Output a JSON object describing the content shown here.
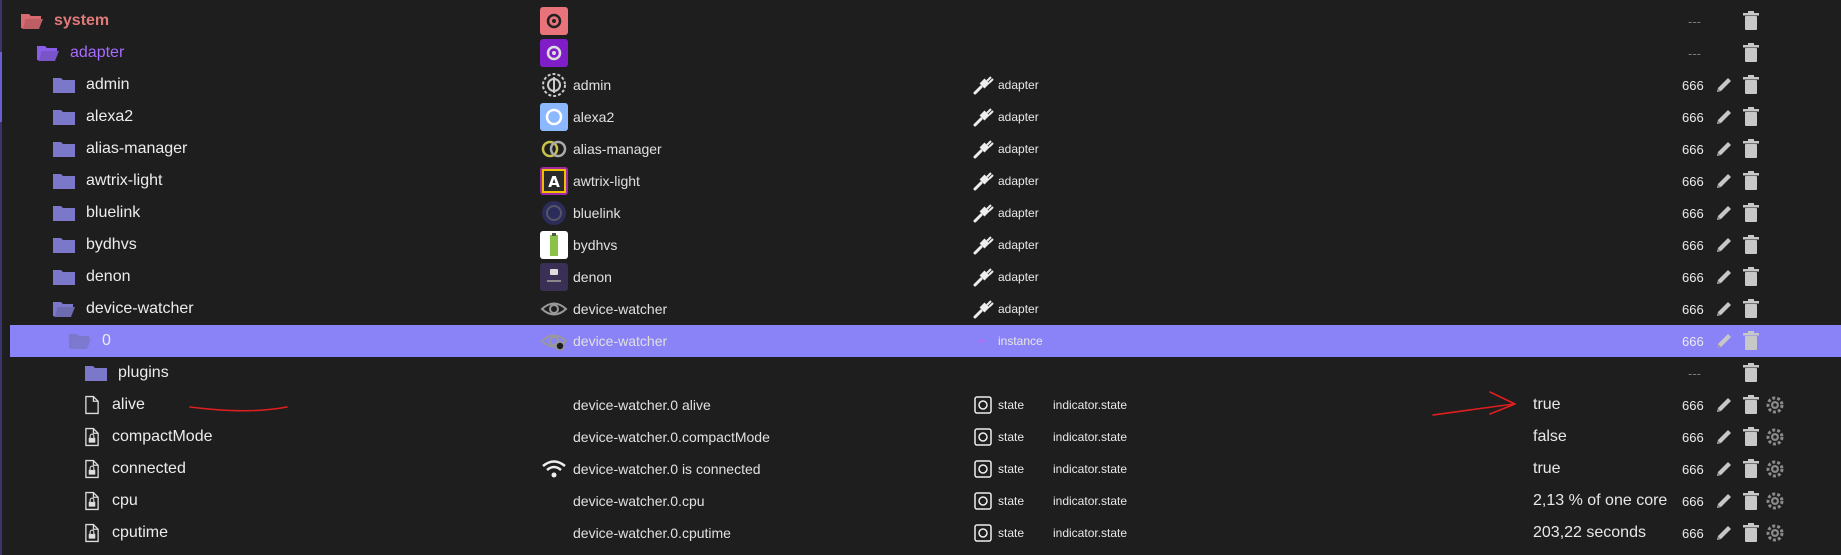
{
  "colors": {
    "background": "#1e1e1e",
    "selected_row": "#8a82f7",
    "system_text": "#e07a7a",
    "adapter_text": "#a66bff",
    "folder": "#7b78c9",
    "annotation": "#e01e1e"
  },
  "rows": [
    {
      "name": "system",
      "level": 0,
      "kind": "folder-open",
      "object": "",
      "type": "",
      "role": "",
      "value": "",
      "acl": "---",
      "edit": false,
      "gear": false
    },
    {
      "name": "adapter",
      "level": 1,
      "kind": "folder-open",
      "object": "",
      "type": "",
      "role": "",
      "value": "",
      "acl": "---",
      "edit": false,
      "gear": false
    },
    {
      "name": "admin",
      "level": 2,
      "kind": "folder",
      "object": "admin",
      "type": "adapter",
      "role": "",
      "value": "",
      "acl": "666",
      "edit": true,
      "gear": false
    },
    {
      "name": "alexa2",
      "level": 2,
      "kind": "folder",
      "object": "alexa2",
      "type": "adapter",
      "role": "",
      "value": "",
      "acl": "666",
      "edit": true,
      "gear": false
    },
    {
      "name": "alias-manager",
      "level": 2,
      "kind": "folder",
      "object": "alias-manager",
      "type": "adapter",
      "role": "",
      "value": "",
      "acl": "666",
      "edit": true,
      "gear": false
    },
    {
      "name": "awtrix-light",
      "level": 2,
      "kind": "folder",
      "object": "awtrix-light",
      "type": "adapter",
      "role": "",
      "value": "",
      "acl": "666",
      "edit": true,
      "gear": false
    },
    {
      "name": "bluelink",
      "level": 2,
      "kind": "folder",
      "object": "bluelink",
      "type": "adapter",
      "role": "",
      "value": "",
      "acl": "666",
      "edit": true,
      "gear": false
    },
    {
      "name": "bydhvs",
      "level": 2,
      "kind": "folder",
      "object": "bydhvs",
      "type": "adapter",
      "role": "",
      "value": "",
      "acl": "666",
      "edit": true,
      "gear": false
    },
    {
      "name": "denon",
      "level": 2,
      "kind": "folder",
      "object": "denon",
      "type": "adapter",
      "role": "",
      "value": "",
      "acl": "666",
      "edit": true,
      "gear": false
    },
    {
      "name": "device-watcher",
      "level": 2,
      "kind": "folder-open",
      "object": "device-watcher",
      "type": "adapter",
      "role": "",
      "value": "",
      "acl": "666",
      "edit": true,
      "gear": false
    },
    {
      "name": "0",
      "level": 3,
      "kind": "folder-open",
      "object": "device-watcher",
      "type": "instance",
      "role": "",
      "value": "",
      "acl": "666",
      "edit": true,
      "gear": false,
      "selected": true
    },
    {
      "name": "plugins",
      "level": 4,
      "kind": "folder",
      "object": "",
      "type": "",
      "role": "",
      "value": "",
      "acl": "---",
      "edit": false,
      "gear": false
    },
    {
      "name": "alive",
      "level": 4,
      "kind": "file",
      "object": "device-watcher.0 alive",
      "type": "state",
      "role": "indicator.state",
      "value": "true",
      "acl": "666",
      "edit": true,
      "gear": true
    },
    {
      "name": "compactMode",
      "level": 4,
      "kind": "file-lock",
      "object": "device-watcher.0.compactMode",
      "type": "state",
      "role": "indicator.state",
      "value": "false",
      "acl": "666",
      "edit": true,
      "gear": true
    },
    {
      "name": "connected",
      "level": 4,
      "kind": "file-lock",
      "object": "device-watcher.0 is connected",
      "type": "state",
      "role": "indicator.state",
      "value": "true",
      "acl": "666",
      "edit": true,
      "gear": true
    },
    {
      "name": "cpu",
      "level": 4,
      "kind": "file-lock",
      "object": "device-watcher.0.cpu",
      "type": "state",
      "role": "indicator.state",
      "value": "2,13 % of one core",
      "acl": "666",
      "edit": true,
      "gear": true
    },
    {
      "name": "cputime",
      "level": 4,
      "kind": "file-lock",
      "object": "device-watcher.0.cputime",
      "type": "state",
      "role": "indicator.state",
      "value": "203,22 seconds",
      "acl": "666",
      "edit": true,
      "gear": true
    }
  ]
}
